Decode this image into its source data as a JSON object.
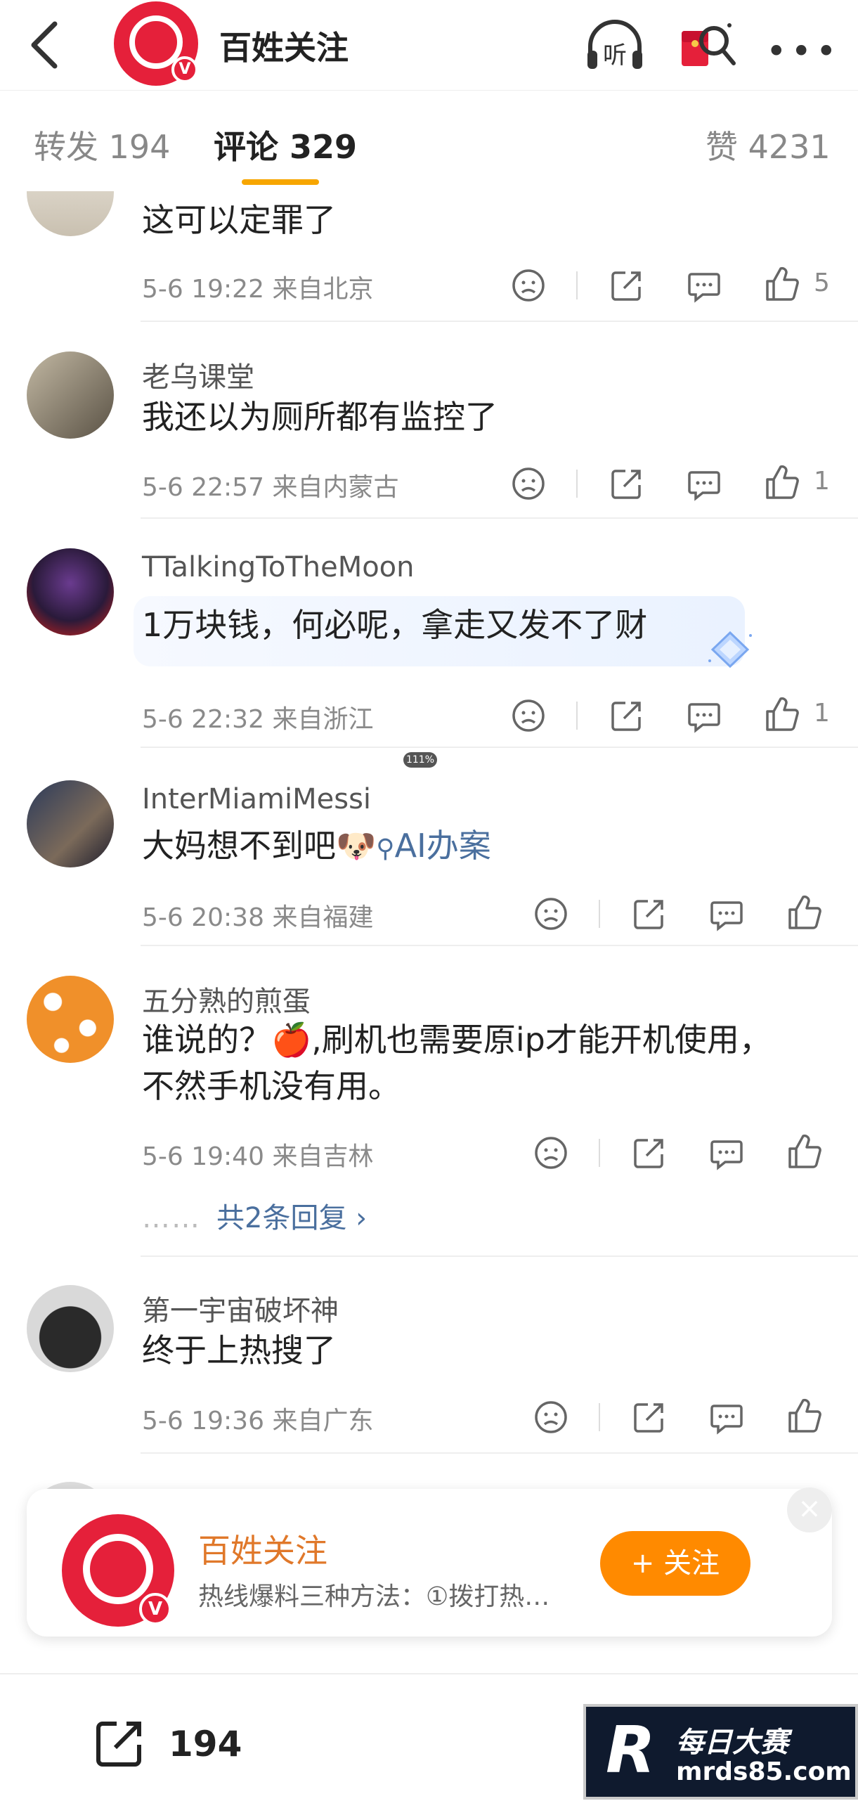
{
  "header": {
    "account_name": "百姓关注",
    "verified_badge": "V",
    "icons": [
      "back-arrow-icon",
      "listen-headphones-icon",
      "red-packet-search-icon",
      "more-dots-icon"
    ],
    "listen_label": "听"
  },
  "tabs": [
    {
      "label": "转发 194",
      "active": false
    },
    {
      "label": "评论 329",
      "active": true
    },
    {
      "label": "赞 4231",
      "active": false
    }
  ],
  "comments": [
    {
      "user": "",
      "text": "这可以定罪了",
      "time": "5-6 19:22",
      "location": "来自北京",
      "likes": "5"
    },
    {
      "user": "老乌课堂",
      "text": "我还以为厕所都有监控了",
      "time": "5-6 22:57",
      "location": "来自内蒙古",
      "likes": "1"
    },
    {
      "user": "TTalkingToTheMoon",
      "text": "1万块钱，何必呢，拿走又发不了财",
      "time": "5-6 22:32",
      "location": "来自浙江",
      "likes": "1"
    },
    {
      "user": "InterMiamiMessi",
      "text": "大妈想不到吧",
      "emoji": "🐶",
      "link": "AI办案",
      "time": "5-6 20:38",
      "location": "来自福建",
      "likes": ""
    },
    {
      "user": "五分熟的煎蛋",
      "text_line1": "谁说的？🍎,刷机也需要原ip才能开机使用，",
      "text_line2": "不然手机没有用。",
      "time": "5-6 19:40",
      "location": "来自吉林",
      "likes": "",
      "replies": "共2条回复 ›",
      "replies_dots": "……"
    },
    {
      "user": "第一宇宙破坏神",
      "text": "终于上热搜了",
      "time": "5-6 19:36",
      "location": "来自广东",
      "likes": ""
    }
  ],
  "zoom_badge": "111%",
  "follow_popup": {
    "name": "百姓关注",
    "description": "热线爆料三种方法：①拨打热…",
    "follow_label": "+ 关注",
    "close_label": "×"
  },
  "bottom_bar": {
    "repost_count": "194"
  },
  "watermark": {
    "logo_letter": "R",
    "text": "每日大赛",
    "url": "mrds85.com"
  },
  "colors": {
    "brand_red": "#e5203a",
    "tab_underline": "#f7a600",
    "follow_orange": "#ff8a00",
    "link_blue": "#4a6f9e"
  }
}
